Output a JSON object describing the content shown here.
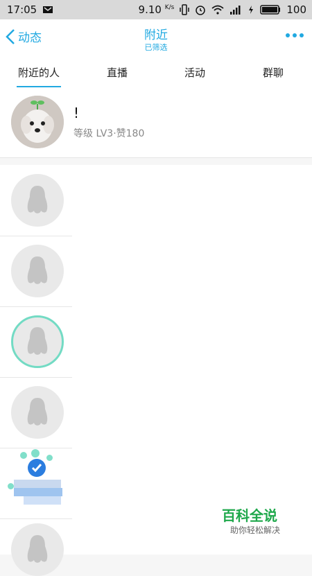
{
  "status_bar": {
    "time": "17:05",
    "network_speed": "9.10",
    "network_unit": "K/s",
    "battery": "100"
  },
  "nav": {
    "back_label": "动态",
    "title": "附近",
    "subtitle": "已筛选"
  },
  "tabs": [
    {
      "label": "附近的人",
      "active": true
    },
    {
      "label": "直播",
      "active": false
    },
    {
      "label": "活动",
      "active": false
    },
    {
      "label": "群聊",
      "active": false
    }
  ],
  "profile": {
    "name": "!",
    "meta": "等级 LV3·赞180"
  },
  "watermark": {
    "title": "百科全说",
    "subtitle": "助你轻松解决"
  },
  "colors": {
    "accent": "#21a9e1",
    "watermark": "#1ea84b"
  }
}
